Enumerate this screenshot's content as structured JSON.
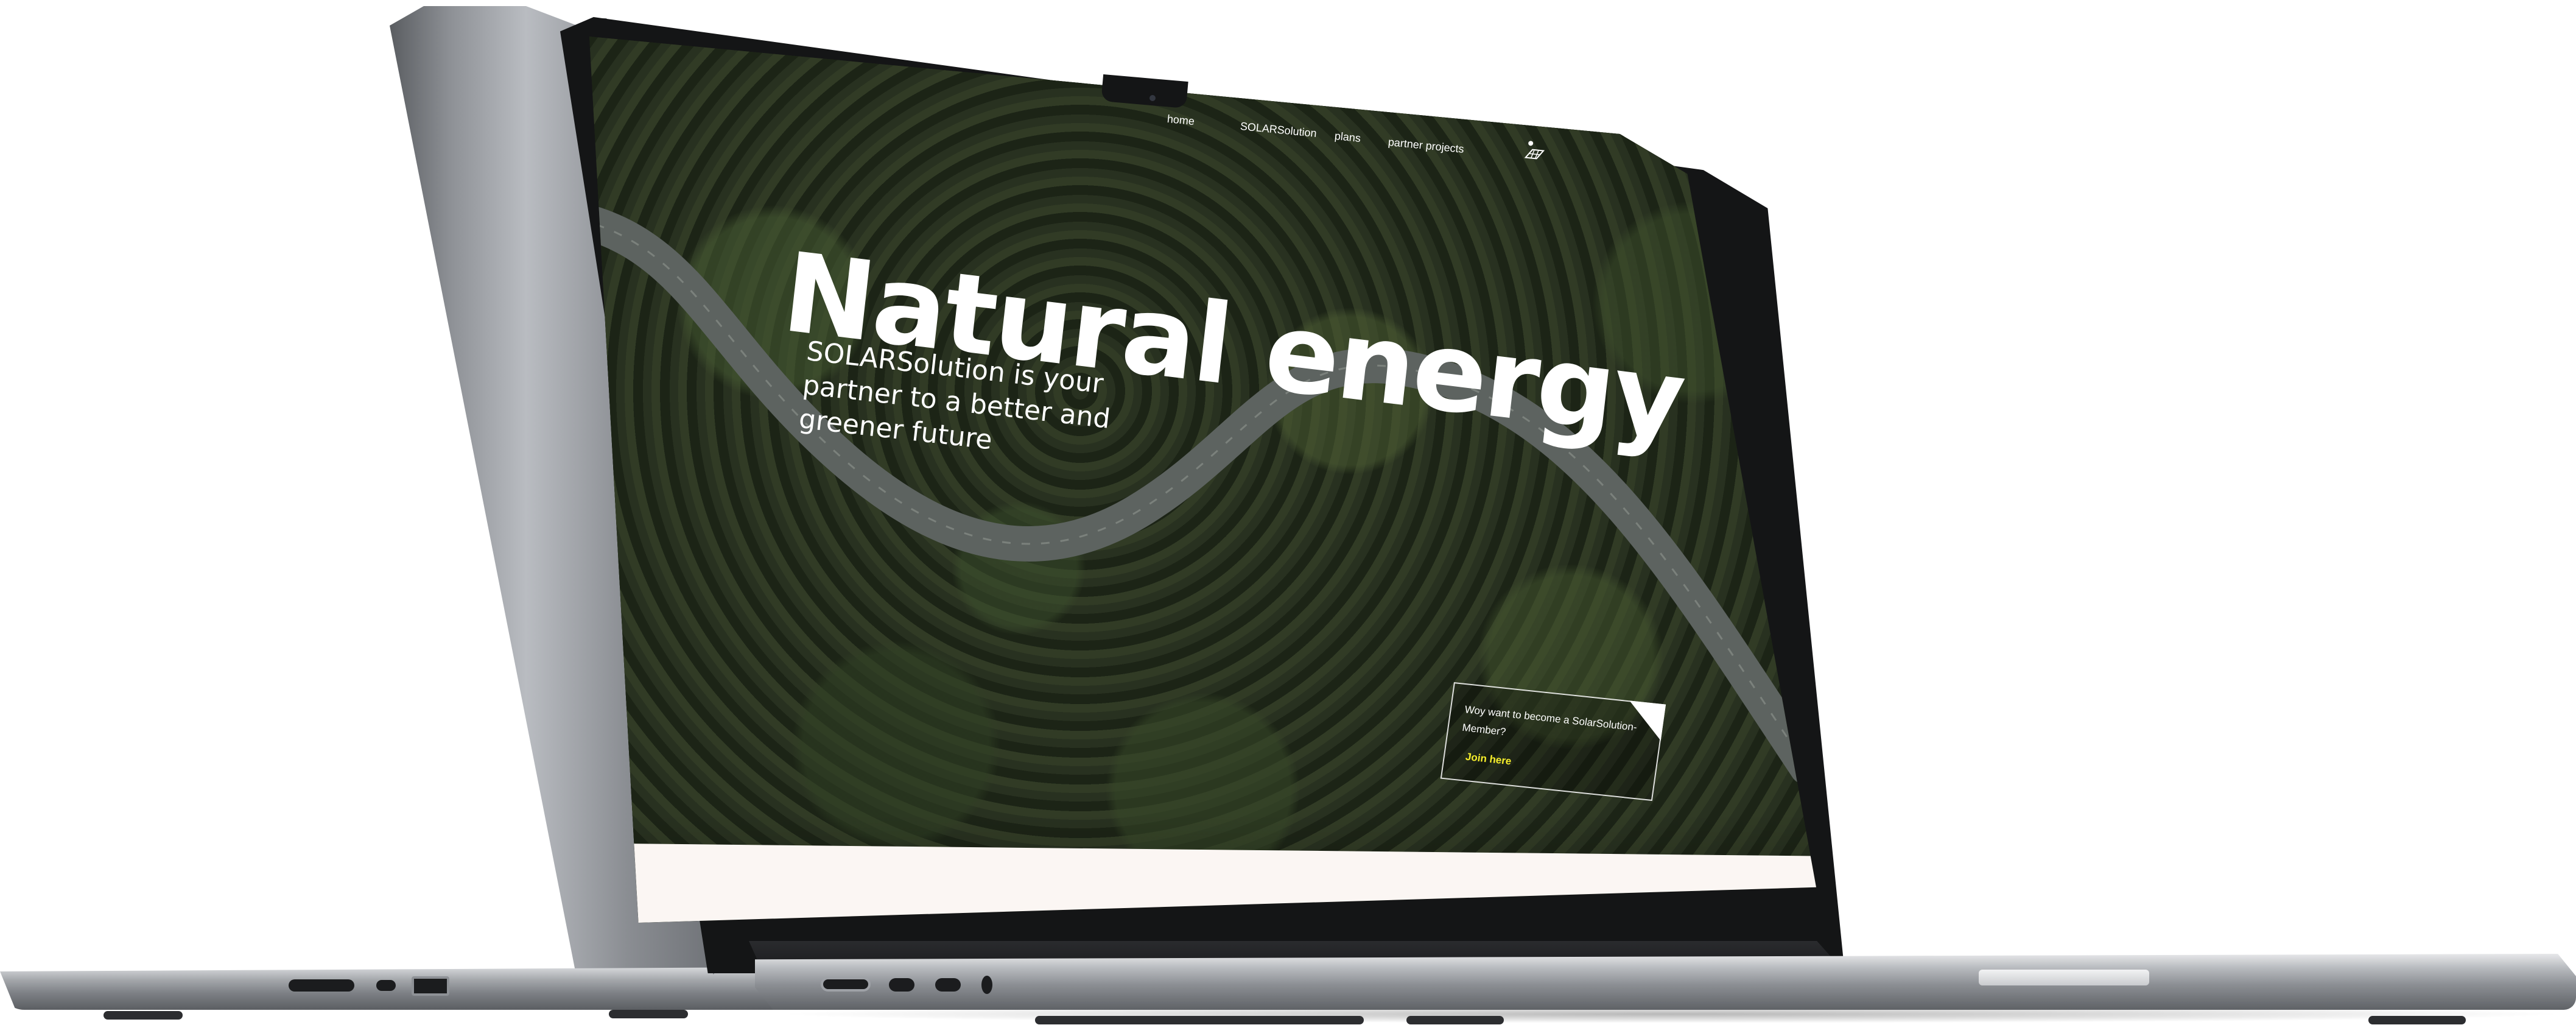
{
  "nav": {
    "items": [
      "home",
      "SOLARSolution",
      "plans",
      "partner projects"
    ],
    "logo_icon": "solar-panel-logo-icon"
  },
  "hero": {
    "title": "Natural energy",
    "subtitle": "SOLARSolution is your partner to a better and greener future"
  },
  "cta": {
    "text": "Woy want to become a SolarSolution-Member?",
    "link": "Join here",
    "link_color": "#f6ee2b"
  },
  "colors": {
    "band": "#fbf6f3",
    "device": "#8c8f94",
    "forest": "#20291a"
  }
}
